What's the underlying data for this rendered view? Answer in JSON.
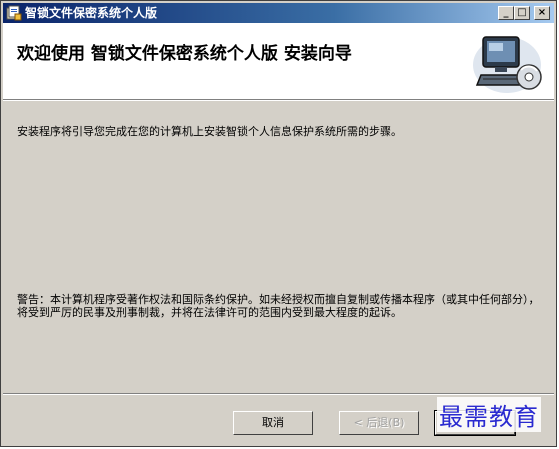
{
  "window": {
    "title": "智锁文件保密系统个人版",
    "buttons": {
      "minimize": "_",
      "maximize": "□",
      "close": "×"
    }
  },
  "banner": {
    "title": "欢迎使用 智锁文件保密系统个人版 安装向导",
    "image_icon": "computer-disc-icon"
  },
  "content": {
    "intro": "安装程序将引导您完成在您的计算机上安装智锁个人信息保护系统所需的步骤。",
    "warning": "警告：本计算机程序受著作权法和国际条约保护。如未经授权而擅自复制或传播本程序（或其中任何部分），将受到严厉的民事及刑事制裁，并将在法律许可的范围内受到最大程度的起诉。"
  },
  "buttons": {
    "cancel": "取消",
    "back": "< 后退(B)",
    "next": ""
  },
  "watermark": "最需教育",
  "colors": {
    "titlebar_start": "#0a246a",
    "titlebar_end": "#a6caf0",
    "face": "#d4d0c8",
    "watermark": "#2a2ad0"
  }
}
